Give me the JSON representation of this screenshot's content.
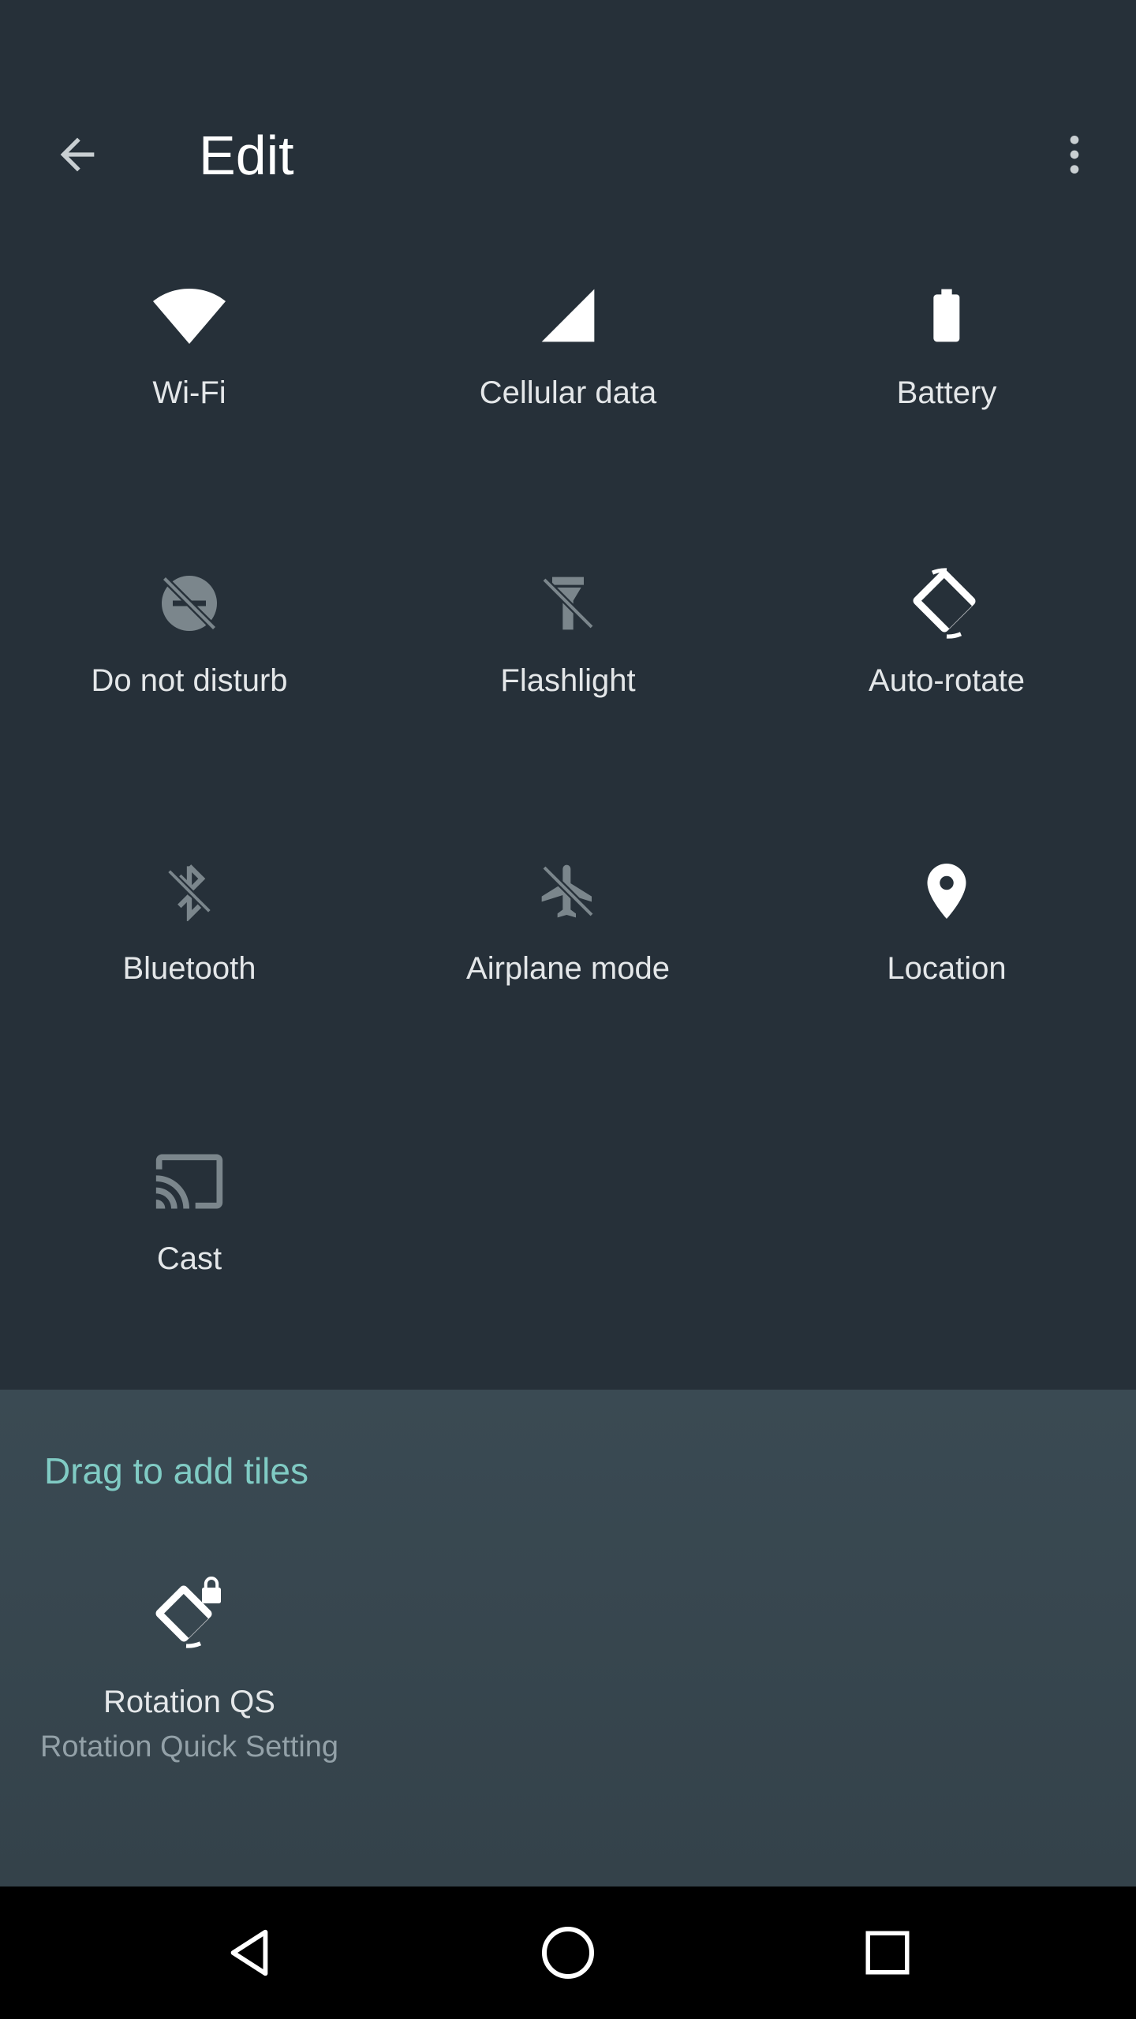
{
  "app_bar": {
    "title": "Edit",
    "back_icon": "arrow-back-icon",
    "more_icon": "more-vert-icon"
  },
  "active_tiles": [
    {
      "label": "Wi-Fi",
      "icon": "wifi-icon"
    },
    {
      "label": "Cellular data",
      "icon": "cellular-signal-icon"
    },
    {
      "label": "Battery",
      "icon": "battery-icon"
    },
    {
      "label": "Do not disturb",
      "icon": "do-not-disturb-off-icon"
    },
    {
      "label": "Flashlight",
      "icon": "flashlight-off-icon"
    },
    {
      "label": "Auto-rotate",
      "icon": "auto-rotate-icon"
    },
    {
      "label": "Bluetooth",
      "icon": "bluetooth-off-icon"
    },
    {
      "label": "Airplane mode",
      "icon": "airplane-off-icon"
    },
    {
      "label": "Location",
      "icon": "location-pin-icon"
    },
    {
      "label": "Cast",
      "icon": "cast-icon"
    }
  ],
  "available": {
    "section_title": "Drag to add tiles",
    "tiles": [
      {
        "label": "Rotation QS",
        "sublabel": "Rotation Quick Setting",
        "icon": "rotation-lock-icon"
      }
    ]
  },
  "colors": {
    "accent": "#80cbc4",
    "background": "#263039",
    "panel": "#37474f"
  },
  "nav_bar": {
    "back": "nav-back-icon",
    "home": "nav-home-icon",
    "recents": "nav-recents-icon"
  }
}
